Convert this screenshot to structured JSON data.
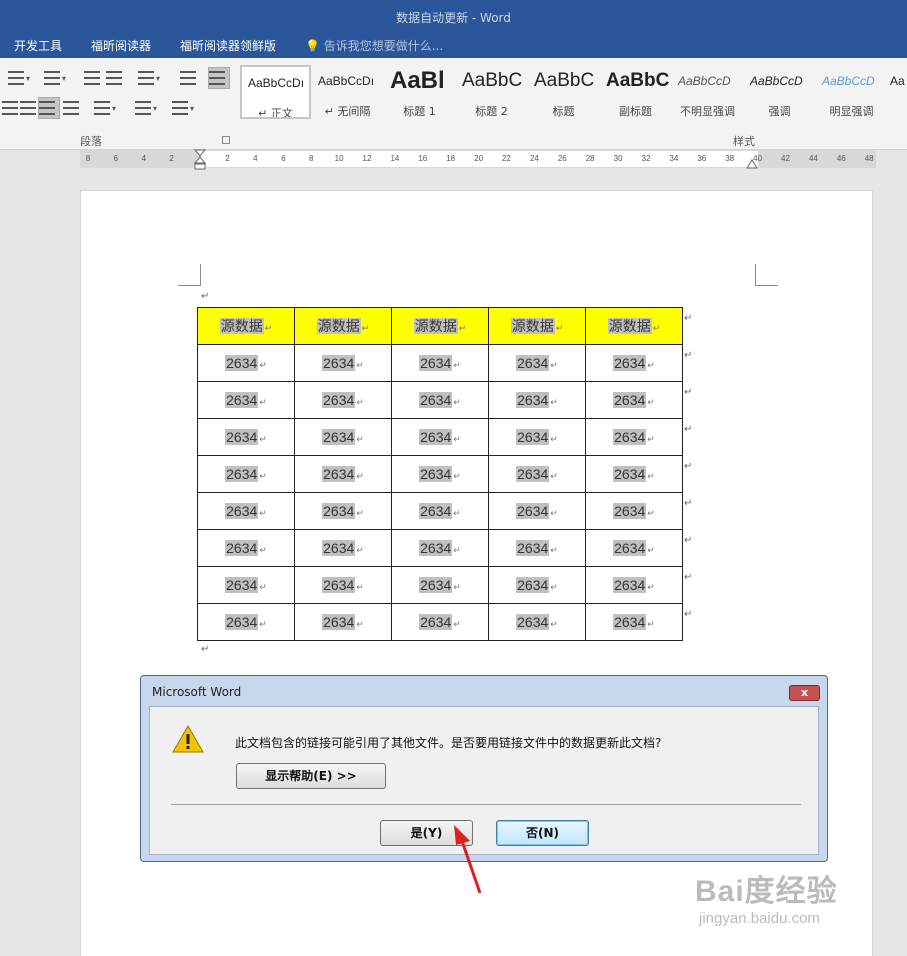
{
  "window": {
    "title": "数据自动更新 - Word"
  },
  "tabs": [
    "开发工具",
    "福昕阅读器",
    "福昕阅读器领鲜版"
  ],
  "tell_me": {
    "placeholder": "告诉我您想要做什么..."
  },
  "ribbon": {
    "paragraph_group_label": "段落",
    "styles_group_label": "样式",
    "styles": [
      {
        "sample": "AaBbCcDı",
        "name": "↵ 正文",
        "selected": true
      },
      {
        "sample": "AaBbCcDı",
        "name": "↵ 无间隔"
      },
      {
        "sample": "AaBl",
        "name": "标题 1"
      },
      {
        "sample": "AaBbC",
        "name": "标题 2"
      },
      {
        "sample": "AaBbC",
        "name": "标题"
      },
      {
        "sample": "AaBbC",
        "name": "副标题"
      },
      {
        "sample": "AaBbCcD",
        "name": "不明显强调"
      },
      {
        "sample": "AaBbCcD",
        "name": "强调"
      },
      {
        "sample": "AaBbCcD",
        "name": "明显强调"
      },
      {
        "sample": "Aa",
        "name": ""
      }
    ]
  },
  "ruler": {
    "numbers": [
      "8",
      "6",
      "4",
      "2",
      "2",
      "4",
      "6",
      "8",
      "10",
      "12",
      "14",
      "16",
      "18",
      "20",
      "22",
      "24",
      "26",
      "28",
      "30",
      "32",
      "34",
      "36",
      "38",
      "40",
      "42",
      "44",
      "46",
      "48"
    ]
  },
  "document": {
    "paragraph_mark": "↵",
    "table": {
      "header": [
        "源数据",
        "源数据",
        "源数据",
        "源数据",
        "源数据"
      ],
      "rows": [
        [
          "2634",
          "2634",
          "2634",
          "2634",
          "2634"
        ],
        [
          "2634",
          "2634",
          "2634",
          "2634",
          "2634"
        ],
        [
          "2634",
          "2634",
          "2634",
          "2634",
          "2634"
        ],
        [
          "2634",
          "2634",
          "2634",
          "2634",
          "2634"
        ],
        [
          "2634",
          "2634",
          "2634",
          "2634",
          "2634"
        ],
        [
          "2634",
          "2634",
          "2634",
          "2634",
          "2634"
        ],
        [
          "2634",
          "2634",
          "2634",
          "2634",
          "2634"
        ],
        [
          "2634",
          "2634",
          "2634",
          "2634",
          "2634"
        ]
      ],
      "header_color": "#ffff00",
      "highlight_color": "#c0c0c0"
    }
  },
  "dialog": {
    "title": "Microsoft Word",
    "close_label": "x",
    "message": "此文档包含的链接可能引用了其他文件。是否要用链接文件中的数据更新此文档?",
    "help_button": "显示帮助(E) >>",
    "yes_button": "是(Y)",
    "no_button": "否(N)",
    "icon": "warning-icon"
  },
  "annotation": {
    "arrow_color": "#e02020"
  },
  "watermark": {
    "brand": "Bai度经验",
    "url": "jingyan.baidu.com"
  }
}
